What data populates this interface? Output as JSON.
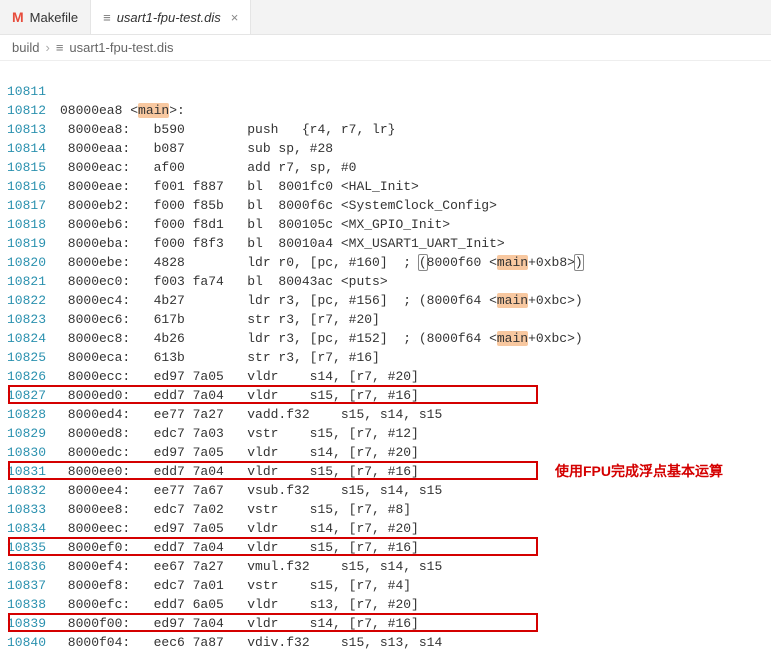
{
  "tabs": [
    {
      "icon": "M",
      "label": "Makefile",
      "active": false
    },
    {
      "icon": "≡",
      "label": "usart1-fpu-test.dis",
      "active": true,
      "closable": true
    }
  ],
  "breadcrumb": {
    "segment1": "build",
    "segment2": "usart1-fpu-test.dis"
  },
  "annotation_text": "使用FPU完成浮点基本运算",
  "lines": [
    {
      "num": "10811",
      "text": ""
    },
    {
      "num": "10812",
      "text": "08000ea8 <",
      "hl": "main",
      "text2": ">:"
    },
    {
      "num": "10813",
      "text": " 8000ea8:   b590        push   {r4, r7, lr}"
    },
    {
      "num": "10814",
      "text": " 8000eaa:   b087        sub sp, #28"
    },
    {
      "num": "10815",
      "text": " 8000eac:   af00        add r7, sp, #0"
    },
    {
      "num": "10816",
      "text": " 8000eae:   f001 f887   bl  8001fc0 <HAL_Init>"
    },
    {
      "num": "10817",
      "text": " 8000eb2:   f000 f85b   bl  8000f6c <SystemClock_Config>"
    },
    {
      "num": "10818",
      "text": " 8000eb6:   f000 f8d1   bl  800105c <MX_GPIO_Init>"
    },
    {
      "num": "10819",
      "text": " 8000eba:   f000 f8f3   bl  80010a4 <MX_USART1_UART_Init>"
    },
    {
      "num": "10820",
      "text": " 8000ebe:   4828        ldr r0, [pc, #160]  ; ",
      "paren_open": "(",
      "text_mid": "8000f60 <",
      "hl": "main",
      "text_after_hl": "+0xb8>",
      "paren_close": ")"
    },
    {
      "num": "10821",
      "text": " 8000ec0:   f003 fa74   bl  80043ac <puts>"
    },
    {
      "num": "10822",
      "text": " 8000ec4:   4b27        ldr r3, [pc, #156]  ; (8000f64 <",
      "hl": "main",
      "text2": "+0xbc>)"
    },
    {
      "num": "10823",
      "text": " 8000ec6:   617b        str r3, [r7, #20]"
    },
    {
      "num": "10824",
      "text": " 8000ec8:   4b26        ldr r3, [pc, #152]  ; (8000f64 <",
      "hl": "main",
      "text2": "+0xbc>)"
    },
    {
      "num": "10825",
      "text": " 8000eca:   613b        str r3, [r7, #16]"
    },
    {
      "num": "10826",
      "text": " 8000ecc:   ed97 7a05   vldr    s14, [r7, #20]"
    },
    {
      "num": "10827",
      "text": " 8000ed0:   edd7 7a04   vldr    s15, [r7, #16]"
    },
    {
      "num": "10828",
      "text": " 8000ed4:   ee77 7a27   vadd.f32    s15, s14, s15"
    },
    {
      "num": "10829",
      "text": " 8000ed8:   edc7 7a03   vstr    s15, [r7, #12]"
    },
    {
      "num": "10830",
      "text": " 8000edc:   ed97 7a05   vldr    s14, [r7, #20]"
    },
    {
      "num": "10831",
      "text": " 8000ee0:   edd7 7a04   vldr    s15, [r7, #16]"
    },
    {
      "num": "10832",
      "text": " 8000ee4:   ee77 7a67   vsub.f32    s15, s14, s15"
    },
    {
      "num": "10833",
      "text": " 8000ee8:   edc7 7a02   vstr    s15, [r7, #8]"
    },
    {
      "num": "10834",
      "text": " 8000eec:   ed97 7a05   vldr    s14, [r7, #20]"
    },
    {
      "num": "10835",
      "text": " 8000ef0:   edd7 7a04   vldr    s15, [r7, #16]"
    },
    {
      "num": "10836",
      "text": " 8000ef4:   ee67 7a27   vmul.f32    s15, s14, s15"
    },
    {
      "num": "10837",
      "text": " 8000ef8:   edc7 7a01   vstr    s15, [r7, #4]"
    },
    {
      "num": "10838",
      "text": " 8000efc:   edd7 6a05   vldr    s13, [r7, #20]"
    },
    {
      "num": "10839",
      "text": " 8000f00:   ed97 7a04   vldr    s14, [r7, #16]"
    },
    {
      "num": "10840",
      "text": " 8000f04:   eec6 7a87   vdiv.f32    s15, s13, s14"
    }
  ],
  "red_boxes": [
    {
      "line_index": 17
    },
    {
      "line_index": 21
    },
    {
      "line_index": 25
    },
    {
      "line_index": 29
    }
  ]
}
